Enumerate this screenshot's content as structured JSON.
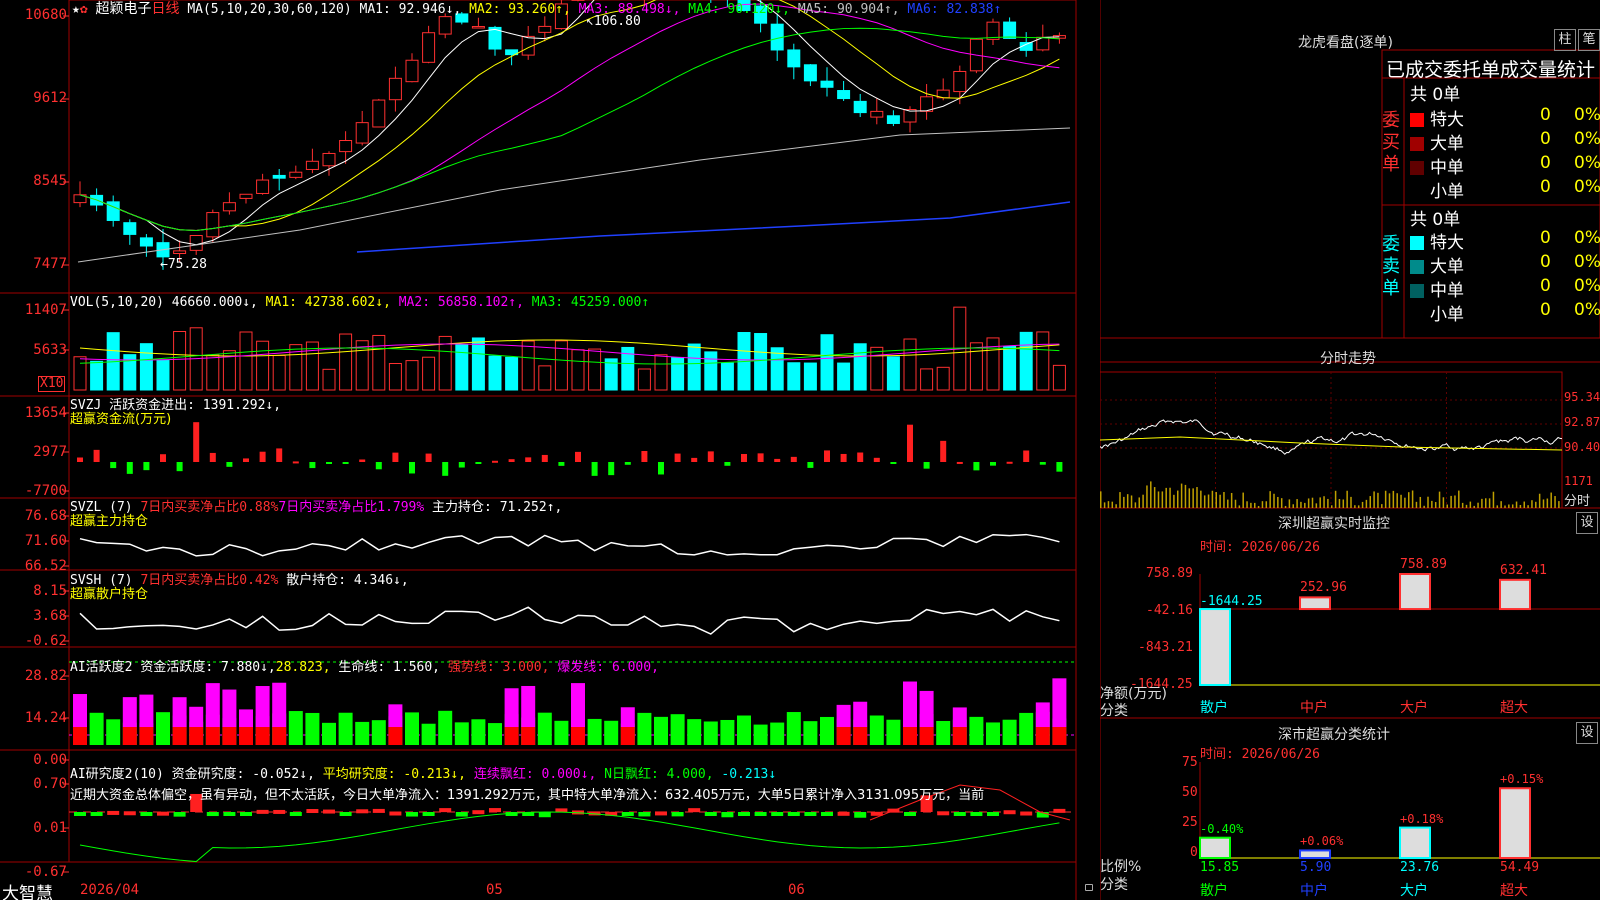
{
  "header": {
    "stock_name": "超颖电子",
    "period": "日线",
    "ma_params": "MA(5,10,20,30,60,120)",
    "ma": [
      {
        "label": "MA1: 92.946↓,",
        "color": "#ffffff"
      },
      {
        "label": "MA2: 93.260↑,",
        "color": "#ffff00"
      },
      {
        "label": "MA3: 88.498↓,",
        "color": "#ff00ff"
      },
      {
        "label": "MA4: 90.120↓,",
        "color": "#00ff00"
      },
      {
        "label": "MA5: 90.904↑,",
        "color": "#c0c0c0"
      },
      {
        "label": "MA6: 82.838↑",
        "color": "#2040ff"
      }
    ],
    "high_marker": "106.80",
    "low_marker": "75.28"
  },
  "price_axis": [
    "10680",
    "9612",
    "8545",
    "7477"
  ],
  "vol": {
    "params": "VOL(5,10,20)",
    "value": "46660.000↓,",
    "ma": [
      {
        "label": "MA1: 42738.602↓,",
        "color": "#ffff00"
      },
      {
        "label": "MA2: 56858.102↑,",
        "color": "#ff00ff"
      },
      {
        "label": "MA3: 45259.000↑",
        "color": "#00ff00"
      }
    ],
    "axis": [
      "11407",
      "5633"
    ],
    "unit": "X10"
  },
  "svzj": {
    "title": "SVZJ  活跃资金进出: 1391.292↓,",
    "subtitle": "超赢资金流(万元)",
    "axis": [
      "13654",
      "2977",
      "-7700"
    ]
  },
  "svzl": {
    "name": "SVZL (7)",
    "a": "7日内买卖净占比0.88%",
    "b": "7日内买卖净占比1.799%",
    "c": "主力持仓: 71.252↑,",
    "subtitle": "超赢主力持仓",
    "axis": [
      "76.68",
      "71.60",
      "66.52"
    ]
  },
  "svsh": {
    "name": "SVSH (7)",
    "a": "7日内买卖净占比0.42%",
    "c": "散户持仓: 4.346↓,",
    "subtitle": "超赢散户持仓",
    "axis": [
      "8.15",
      "3.68",
      "-0.62"
    ]
  },
  "ai1": {
    "name": "AI活跃度2",
    "a": "资金活跃度: 7.880↓,",
    "b": "28.823,",
    "c": "生命线: 1.560,",
    "d": "强势线: 3.000,",
    "e": "爆发线: 6.000,",
    "axis": [
      "28.82",
      "14.24",
      "0.00"
    ]
  },
  "ai2": {
    "name": "AI研究度2(10)",
    "a": "资金研究度: -0.052↓,",
    "b": "平均研究度: -0.213↓,",
    "c": "连续飘红: 0.000↓,",
    "d": "N日飘红: 4.000,",
    "e": "-0.213↓",
    "comment": "近期大资金总体偏空，虽有异动，但不太活跃，今日大单净流入：1391.292万元，其中特大单净流入：632.405万元，大单5日累计净入3131.095万元，当前",
    "axis": [
      "0.70",
      "0.01",
      "-0.67"
    ]
  },
  "footer": {
    "brand": "大智慧",
    "date_start": "2026/04",
    "month_05": "05",
    "month_06": "06"
  },
  "lhb": {
    "title": "龙虎看盘(逐单)",
    "btn_zhu": "柱",
    "btn_bi": "笔",
    "heading": "已成交委托单成交量统计",
    "buy_label": "委买单",
    "sell_label": "委卖单",
    "buy_total": "共 0单",
    "sell_total": "共 0单",
    "buy_rows": [
      {
        "name": "特大",
        "count": "0",
        "pct": "0%",
        "color": "#ff0000"
      },
      {
        "name": "大单",
        "count": "0",
        "pct": "0%",
        "color": "#a00000"
      },
      {
        "name": "中单",
        "count": "0",
        "pct": "0%",
        "color": "#600000"
      },
      {
        "name": "小单",
        "count": "0",
        "pct": "0%",
        "color": ""
      }
    ],
    "sell_rows": [
      {
        "name": "特大",
        "count": "0",
        "pct": "0%",
        "color": "#00ffff"
      },
      {
        "name": "大单",
        "count": "0",
        "pct": "0%",
        "color": "#008b8b"
      },
      {
        "name": "中单",
        "count": "0",
        "pct": "0%",
        "color": "#006060"
      },
      {
        "name": "小单",
        "count": "0",
        "pct": "0%",
        "color": ""
      }
    ]
  },
  "fenshi": {
    "title": "分时走势",
    "axis": [
      "95.34",
      "92.87",
      "90.40",
      "1171"
    ],
    "corner": "分时"
  },
  "monitor": {
    "title": "深圳超赢实时监控",
    "btn": "设",
    "date": "时间: 2026/06/26",
    "axis": [
      "758.89",
      "-42.16",
      "-843.21",
      "-1644.25"
    ],
    "ylabel": "净额(万元)",
    "xlabel": "分类",
    "categories": [
      "散户",
      "中户",
      "大户",
      "超大"
    ],
    "values": [
      -1644.25,
      252.96,
      758.89,
      632.41
    ],
    "value_labels": [
      "-1644.25",
      "252.96",
      "758.89",
      "632.41"
    ]
  },
  "classify": {
    "title": "深市超赢分类统计",
    "btn": "设",
    "date": "时间: 2026/06/26",
    "axis": [
      "75",
      "50",
      "25",
      "0"
    ],
    "ylabel": "比例%",
    "xlabel": "分类",
    "categories": [
      "散户",
      "中户",
      "大户",
      "超大"
    ],
    "values": [
      15.85,
      5.9,
      23.76,
      54.49
    ],
    "value_labels": [
      "15.85",
      "5.90",
      "23.76",
      "54.49"
    ],
    "changes": [
      "-0.40%",
      "+0.06%",
      "+0.18%",
      "+0.15%"
    ]
  },
  "chart_data": [
    {
      "type": "bar",
      "title": "深圳超赢实时监控",
      "categories": [
        "散户",
        "中户",
        "大户",
        "超大"
      ],
      "values": [
        -1644.25,
        252.96,
        758.89,
        632.41
      ],
      "ylabel": "净额(万元)",
      "xlabel": "分类",
      "ylim": [
        -1644.25,
        758.89
      ]
    },
    {
      "type": "bar",
      "title": "深市超赢分类统计",
      "categories": [
        "散户",
        "中户",
        "大户",
        "超大"
      ],
      "values": [
        15.85,
        5.9,
        23.76,
        54.49
      ],
      "ylabel": "比例%",
      "xlabel": "分类",
      "ylim": [
        0,
        75
      ]
    }
  ]
}
